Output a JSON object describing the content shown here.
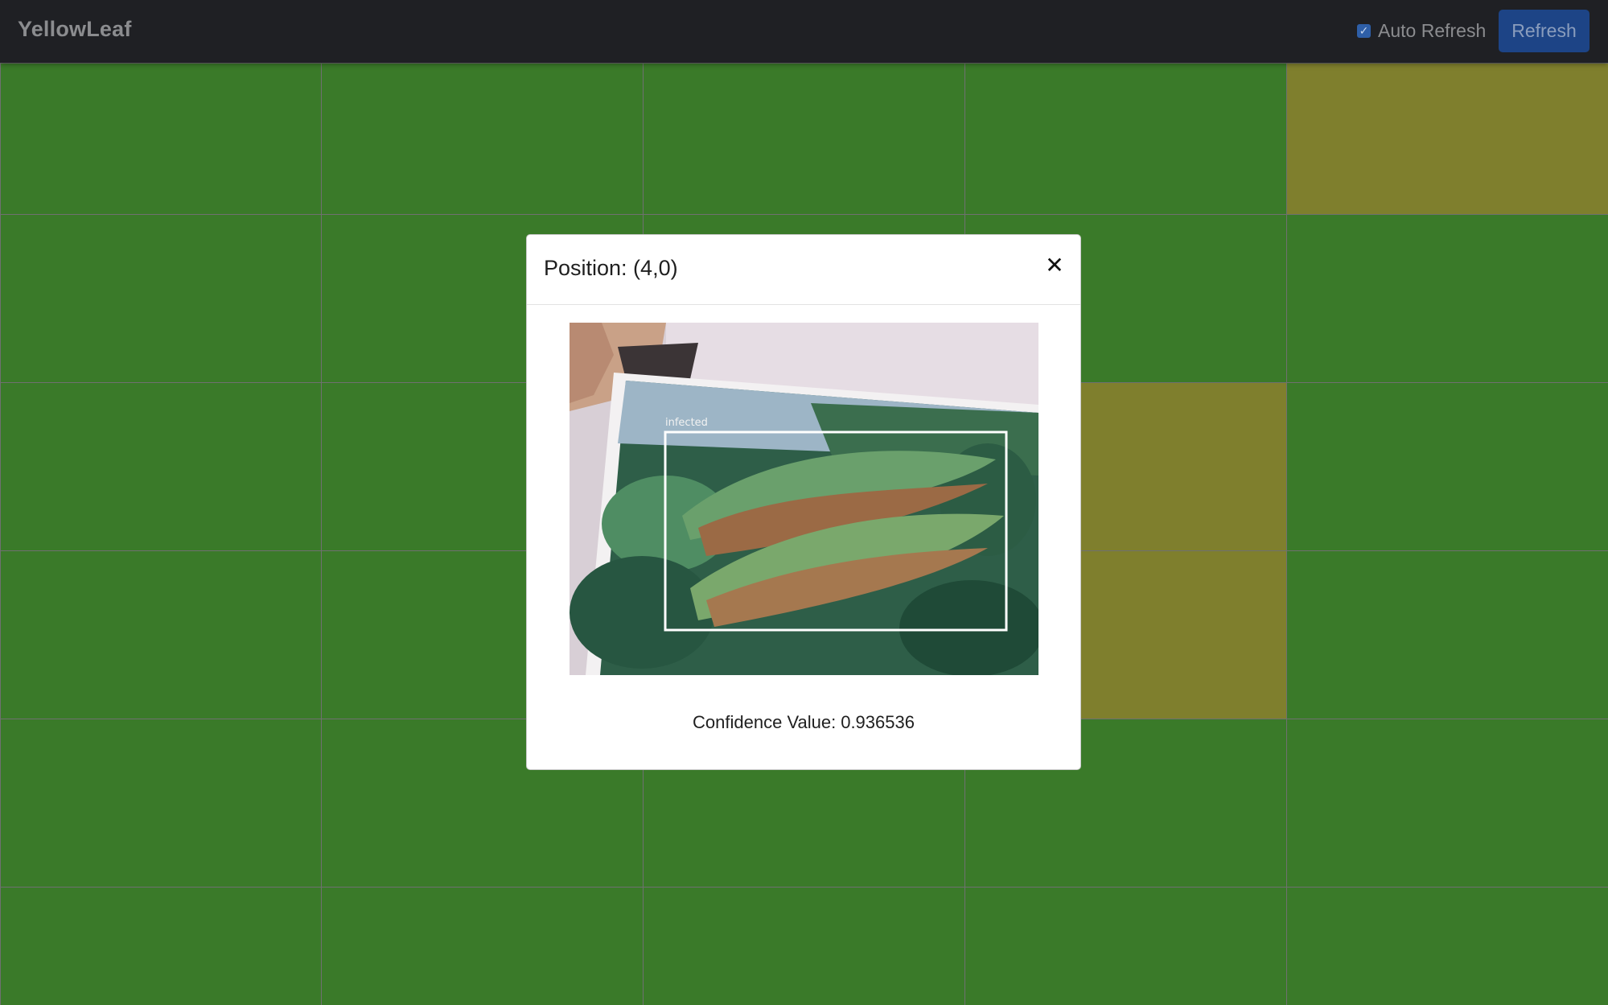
{
  "navbar": {
    "brand": "YellowLeaf",
    "auto_refresh_label": "Auto Refresh",
    "auto_refresh_checked": true,
    "refresh_label": "Refresh"
  },
  "grid": {
    "columns": 5,
    "rows": 6,
    "healthy_color": "#3a7a29",
    "infected_color": "#7f7f2d",
    "infected_cells": [
      [
        4,
        0
      ],
      [
        3,
        2
      ],
      [
        3,
        3
      ]
    ]
  },
  "modal": {
    "title": "Position: (4,0)",
    "close_icon": "close-icon",
    "image_label": "infected",
    "confidence_label": "Confidence Value:",
    "confidence_value": "0.936536"
  }
}
